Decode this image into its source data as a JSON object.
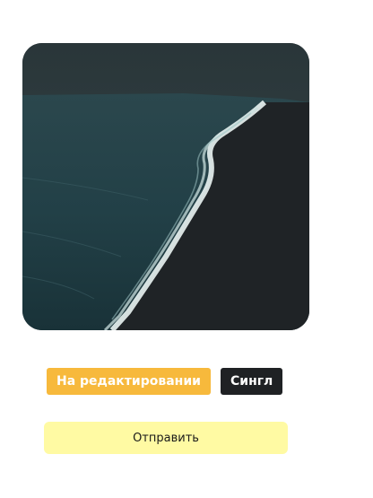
{
  "release": {
    "cover": {
      "alt_colors": {
        "sky": "#2f3a3d",
        "sea": "#1f4148",
        "sand": "#1e2225",
        "surf": "#e9f3f2"
      }
    },
    "status_badge": "На редактировании",
    "type_badge": "Сингл",
    "submit_label": "Отправить"
  },
  "colors": {
    "status_badge_bg": "#f7b93c",
    "type_badge_bg": "#1f2124",
    "submit_bg": "#fffaa3"
  }
}
